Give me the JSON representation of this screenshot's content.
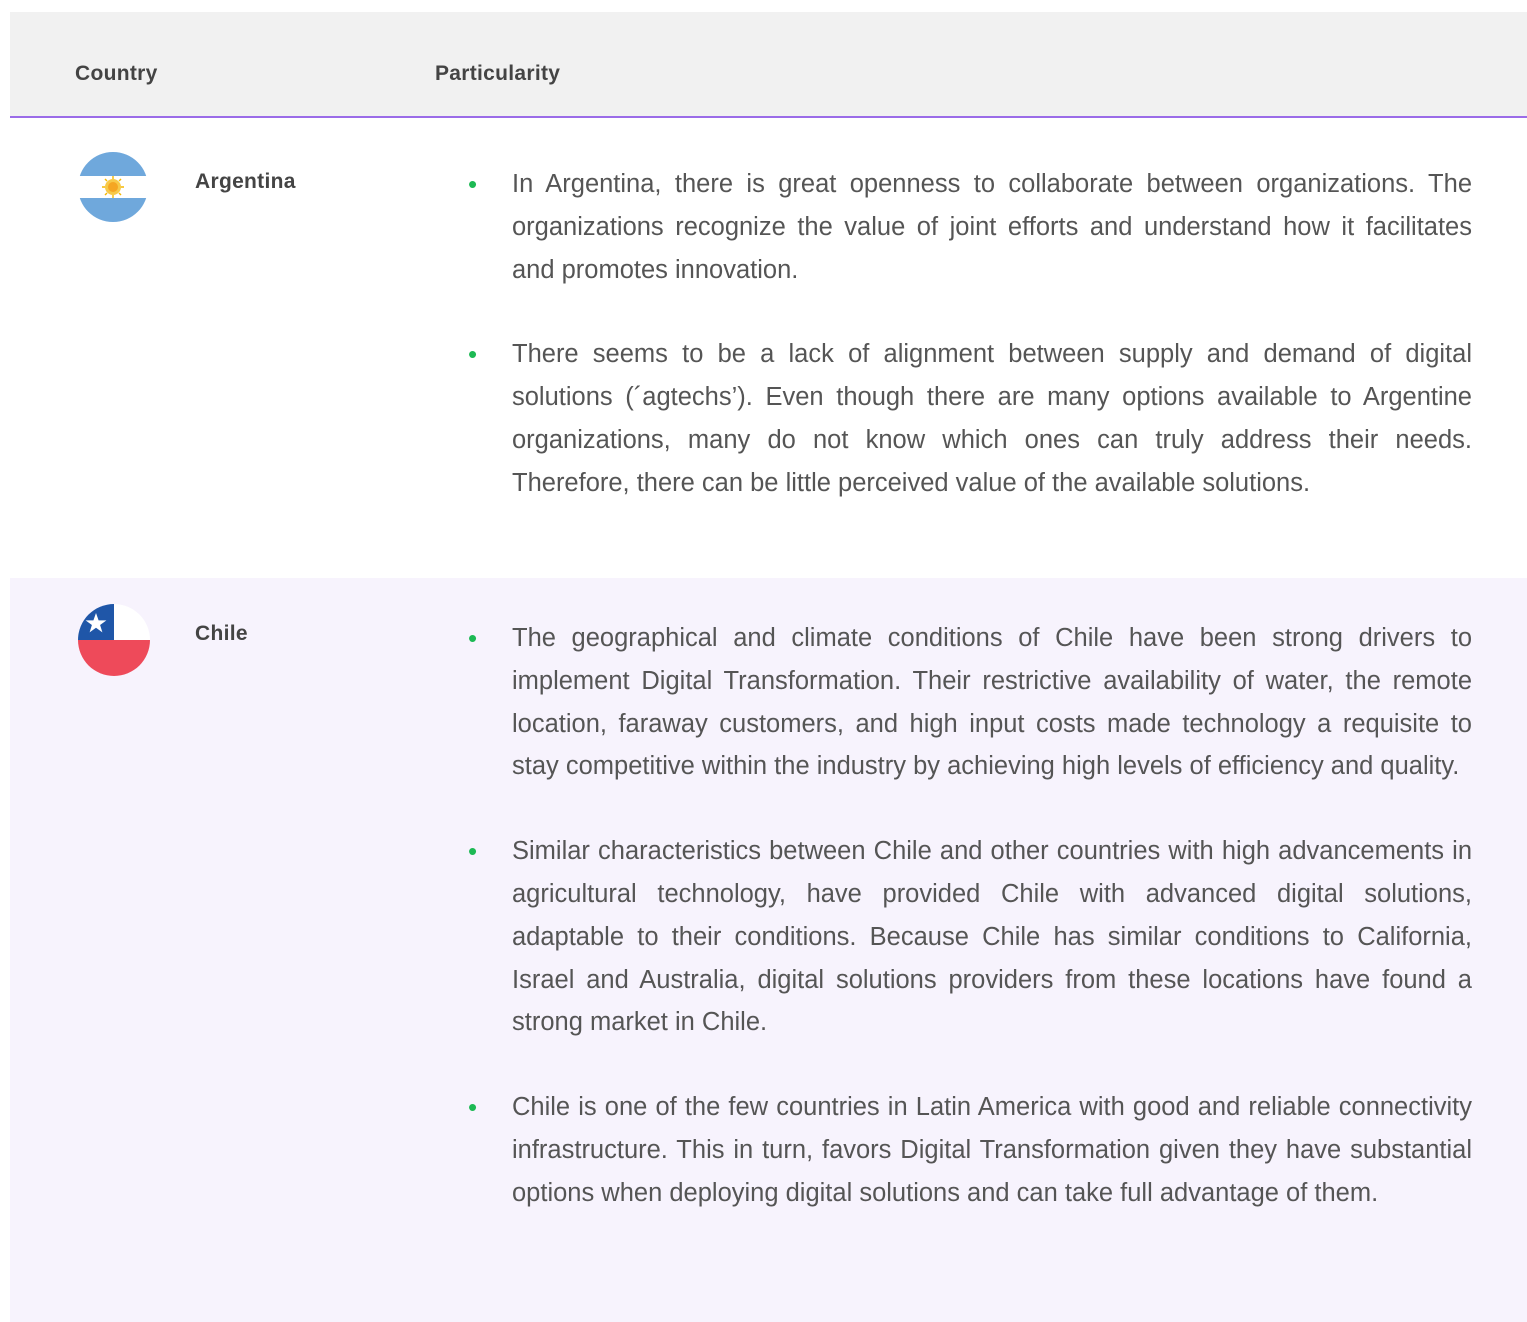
{
  "header": {
    "country_label": "Country",
    "particularity_label": "Particularity"
  },
  "rows": [
    {
      "country": "Argentina",
      "flag_icon": "argentina-flag-icon",
      "flag_colors": {
        "blue": "#6fa8dc",
        "white": "#ffffff",
        "sun": "#f5b800"
      },
      "bullets": [
        "In Argentina, there is great openness to collaborate between organizations. The organizations recognize the value of joint efforts and understand how it facilitates and promotes innovation.",
        "There seems to be a lack of alignment between supply and demand of digital solutions (´agtechs’). Even though there are many options available to Argentine organizations, many do not know which ones can truly address their needs. Therefore, there can be little perceived value of the available solutions."
      ]
    },
    {
      "country": "Chile",
      "flag_icon": "chile-flag-icon",
      "flag_colors": {
        "blue": "#1f56a8",
        "white": "#ffffff",
        "red": "#ee4a5a"
      },
      "bullets": [
        "The geographical and climate conditions of Chile have been strong drivers to implement Digital Transformation. Their restrictive availability of water, the remote location, faraway customers, and high input costs made technology a requisite to stay competitive within the industry by achieving high levels of efficiency and quality.",
        "Similar characteristics between Chile and other countries with high advancements in agricultural technology, have provided Chile with advanced digital solutions, adaptable to their conditions. Because Chile has similar conditions to California, Israel and Australia, digital solutions providers from these locations have found a strong market in Chile.",
        "Chile is one of the few countries in Latin America with good and reliable connectivity infrastructure. This in turn, favors Digital Transformation given they have substantial options when deploying digital solutions and can take full advantage of them."
      ]
    }
  ],
  "colors": {
    "header_bg": "#f1f1f1",
    "header_rule": "#9b6ce8",
    "alt_row_bg": "#f7f3fd",
    "bullet": "#1db954",
    "text": "#555555"
  }
}
